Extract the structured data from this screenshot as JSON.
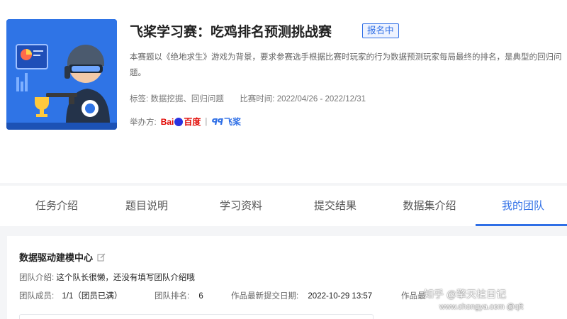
{
  "competition": {
    "title": "飞桨学习赛：吃鸡排名预测挑战赛",
    "status": "报名中",
    "description": "本赛题以《绝地求生》游戏为背景，要求参赛选手根据比赛时玩家的行为数据预测玩家每局最终的排名，是典型的回归问题。",
    "tags_label": "标签:",
    "tags": "数据挖掘、回归问题",
    "time_label": "比赛时间:",
    "time_range": "2022/04/26 - 2022/12/31",
    "organizer_label": "举办方:",
    "organizer_baidu_a": "Bai",
    "organizer_baidu_b": "百度",
    "organizer_separator": "|",
    "organizer_paddle_mark": "ꟼꟼ",
    "organizer_paddle": "飞桨"
  },
  "tabs": [
    {
      "label": "任务介绍",
      "active": false
    },
    {
      "label": "题目说明",
      "active": false
    },
    {
      "label": "学习资料",
      "active": false
    },
    {
      "label": "提交结果",
      "active": false
    },
    {
      "label": "数据集介绍",
      "active": false
    },
    {
      "label": "我的团队",
      "active": true
    }
  ],
  "team": {
    "name": "数据驱动建模中心",
    "intro_label": "团队介绍:",
    "intro": "这个队长很懒，还没有填写团队介绍哦",
    "members_label": "团队成员:",
    "members": "1/1（团员已满）",
    "rank_label": "团队排名:",
    "rank": "6",
    "latest_submit_label": "作品最新提交日期:",
    "latest_submit": "2022-10-29 13:57",
    "best_label": "作品最"
  },
  "watermark": {
    "line1": "知乎 @擎天柱日记",
    "line2": "www.chongya.com @qft"
  },
  "colors": {
    "accent": "#2f6fe6",
    "banner_bg": "#2f74e6",
    "baidu_red": "#e10601"
  }
}
